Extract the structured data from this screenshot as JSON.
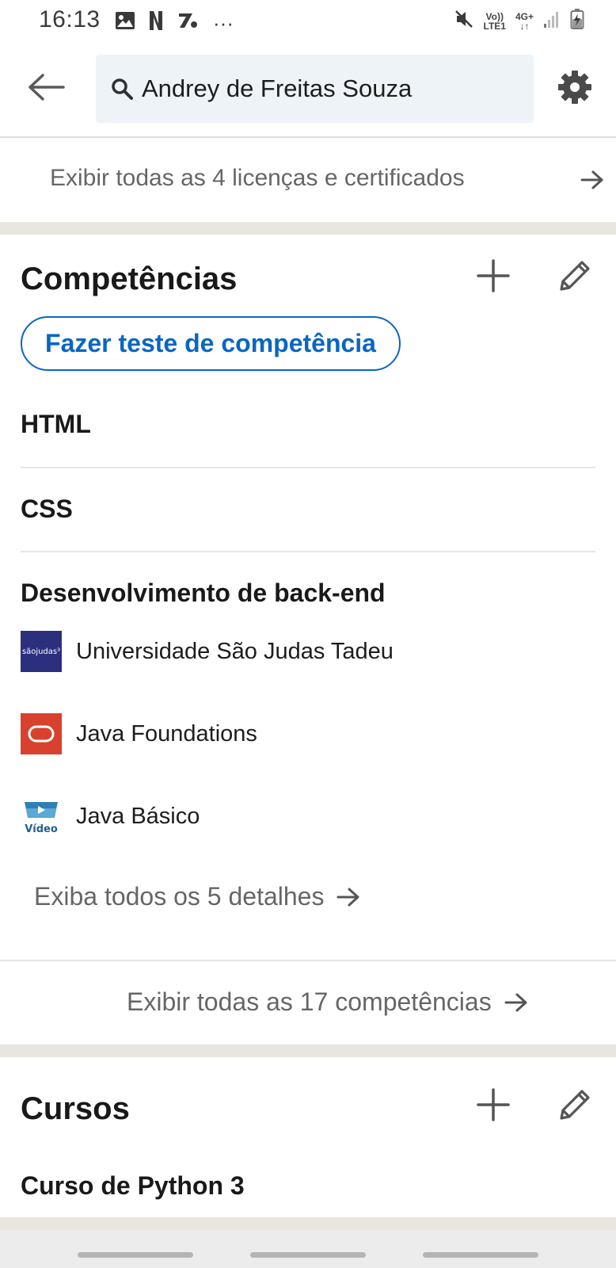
{
  "status_bar": {
    "time": "16:13",
    "ellipsis": "···",
    "volte_top": "Vo))",
    "volte_bottom": "LTE1",
    "network_top": "4G+",
    "network_bottom": "↓↑"
  },
  "header": {
    "search_value": "Andrey de Freitas Souza"
  },
  "licenses": {
    "link_label": "Exibir todas as 4 licenças e certificados"
  },
  "skills_section": {
    "title": "Competências",
    "skill_test_label": "Fazer teste de competência",
    "skills": [
      {
        "name": "HTML"
      },
      {
        "name": "CSS"
      },
      {
        "name": "Desenvolvimento de back-end"
      }
    ],
    "associations": [
      {
        "label": "Universidade São Judas Tadeu",
        "logo_text": "sãojudas³"
      },
      {
        "label": "Java Foundations"
      },
      {
        "label": "Java Básico",
        "logo_text": "Vídeo"
      }
    ],
    "details_link": "Exiba todos os 5 detalhes",
    "all_skills_link": "Exibir todas as 17 competências"
  },
  "courses_section": {
    "title": "Cursos",
    "courses": [
      {
        "name": "Curso de Python 3"
      }
    ]
  },
  "colors": {
    "accent": "#0a66c2",
    "oracle_red": "#d9412f",
    "saojudas_navy": "#2b2f7e",
    "section_gap": "#e9e5df"
  }
}
